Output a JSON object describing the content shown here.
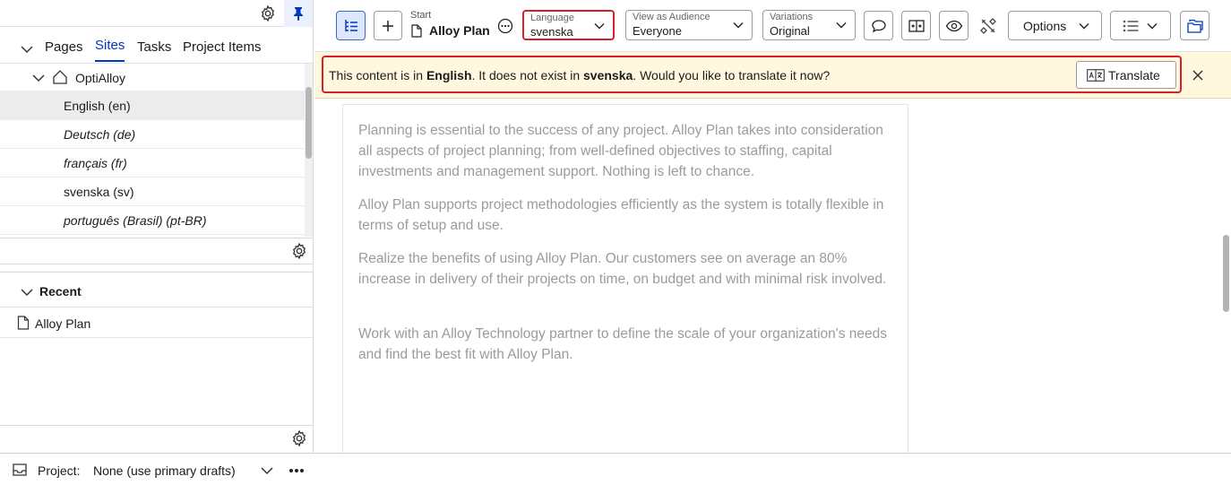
{
  "left_panel": {
    "tabs": [
      {
        "label": "Pages"
      },
      {
        "label": "Sites"
      },
      {
        "label": "Tasks"
      },
      {
        "label": "Project Items"
      }
    ],
    "active_tab": "Sites",
    "tree": {
      "root_label": "OptiAlloy",
      "items": [
        {
          "label": "English (en)"
        },
        {
          "label": "Deutsch (de)"
        },
        {
          "label": "français (fr)"
        },
        {
          "label": "svenska (sv)"
        },
        {
          "label": "português (Brasil) (pt-BR)"
        }
      ]
    },
    "recent": {
      "title": "Recent",
      "items": [
        {
          "label": "Alloy Plan"
        }
      ]
    }
  },
  "bottom_bar": {
    "project_label": "Project:",
    "project_value": "None (use primary drafts)"
  },
  "toolbar": {
    "breadcrumb_parent": "Start",
    "page_title": "Alloy Plan",
    "language": {
      "label": "Language",
      "value": "svenska"
    },
    "audience": {
      "label": "View as Audience",
      "value": "Everyone"
    },
    "variations": {
      "label": "Variations",
      "value": "Original"
    },
    "options_label": "Options"
  },
  "notice": {
    "part1": "This content is in ",
    "source_lang": "English",
    "part2": ". It does not exist in ",
    "target_lang": "svenska",
    "part3": ". Would you like to translate it now?",
    "translate_label": "Translate"
  },
  "content": {
    "paragraphs": [
      "Planning is essential to the success of any project. Alloy Plan takes into consideration all aspects of project planning; from well-defined objectives to staffing, capital investments and management support. Nothing is left to chance.",
      "Alloy Plan supports project methodologies efficiently as the system is totally flexible in terms of setup and use.",
      "Realize the benefits of using Alloy Plan. Our customers see on average an 80% increase in delivery of their projects on time, on budget and with minimal risk involved.",
      "Work with an Alloy Technology partner to define the scale of your organization's needs and find the best fit with Alloy Plan."
    ]
  },
  "colors": {
    "accent": "#0037c1",
    "highlight_border": "#d6202b",
    "notice_bg": "#fff8de"
  }
}
